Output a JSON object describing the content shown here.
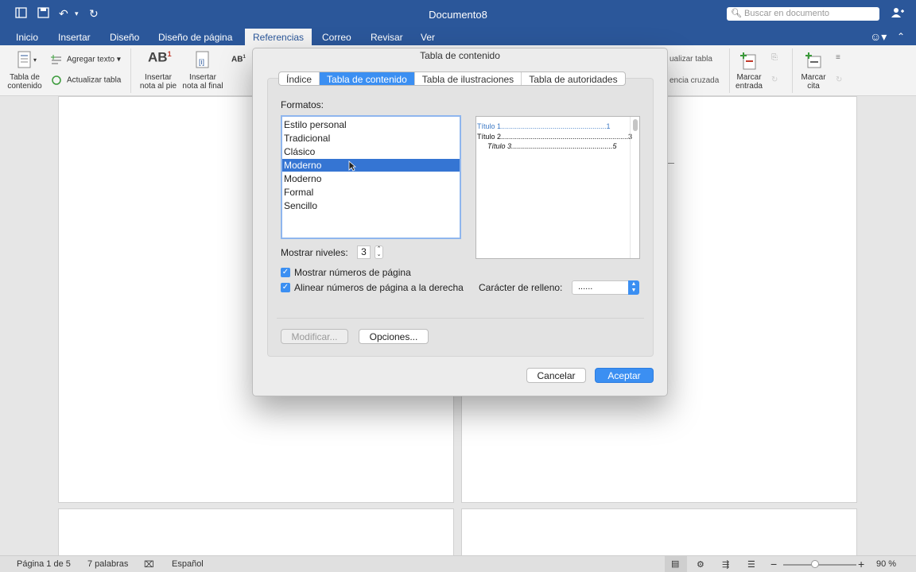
{
  "window": {
    "title": "Documento8",
    "search_placeholder": "Buscar en documento"
  },
  "ribbon_tabs": [
    "Inicio",
    "Insertar",
    "Diseño",
    "Diseño de página",
    "Referencias",
    "Correo",
    "Revisar",
    "Ver"
  ],
  "active_tab": "Referencias",
  "ribbon": {
    "toc_button": [
      "Tabla de",
      "contenido"
    ],
    "add_text": "Agregar texto",
    "update_table": "Actualizar tabla",
    "insert_footnote": [
      "Insertar",
      "nota al pie"
    ],
    "insert_endnote": [
      "Insertar",
      "nota al final"
    ],
    "update_table_right": "ualizar tabla",
    "cross_ref": "encia cruzada",
    "mark_entry": [
      "Marcar",
      "entrada"
    ],
    "mark_citation": [
      "Marcar",
      "cita"
    ]
  },
  "dialog": {
    "title": "Tabla de contenido",
    "tabs": [
      "Índice",
      "Tabla de contenido",
      "Tabla de ilustraciones",
      "Tabla de autoridades"
    ],
    "selected_tab": 1,
    "formats_label": "Formatos:",
    "formats": [
      "Estilo personal",
      "Tradicional",
      "Clásico",
      "Moderno",
      "Moderno",
      "Formal",
      "Sencillo"
    ],
    "selected_format": 3,
    "preview": [
      {
        "text": "Título 1",
        "page": "1"
      },
      {
        "text": "Título 2",
        "page": "3"
      },
      {
        "text": "Título 3",
        "page": "5"
      }
    ],
    "show_levels_label": "Mostrar niveles:",
    "show_levels_value": "3",
    "show_page_numbers": "Mostrar números de página",
    "align_page_numbers": "Alinear números de página a la derecha",
    "fill_char_label": "Carácter de relleno:",
    "fill_char_value": "......",
    "modify_button": "Modificar...",
    "options_button": "Opciones...",
    "cancel_button": "Cancelar",
    "accept_button": "Aceptar"
  },
  "status": {
    "page": "Página 1 de 5",
    "words": "7 palabras",
    "language": "Español",
    "zoom": "90 %"
  },
  "colors": {
    "title_bar": "#2b579a",
    "accent": "#3b8ff2",
    "selection": "#3575d3"
  }
}
